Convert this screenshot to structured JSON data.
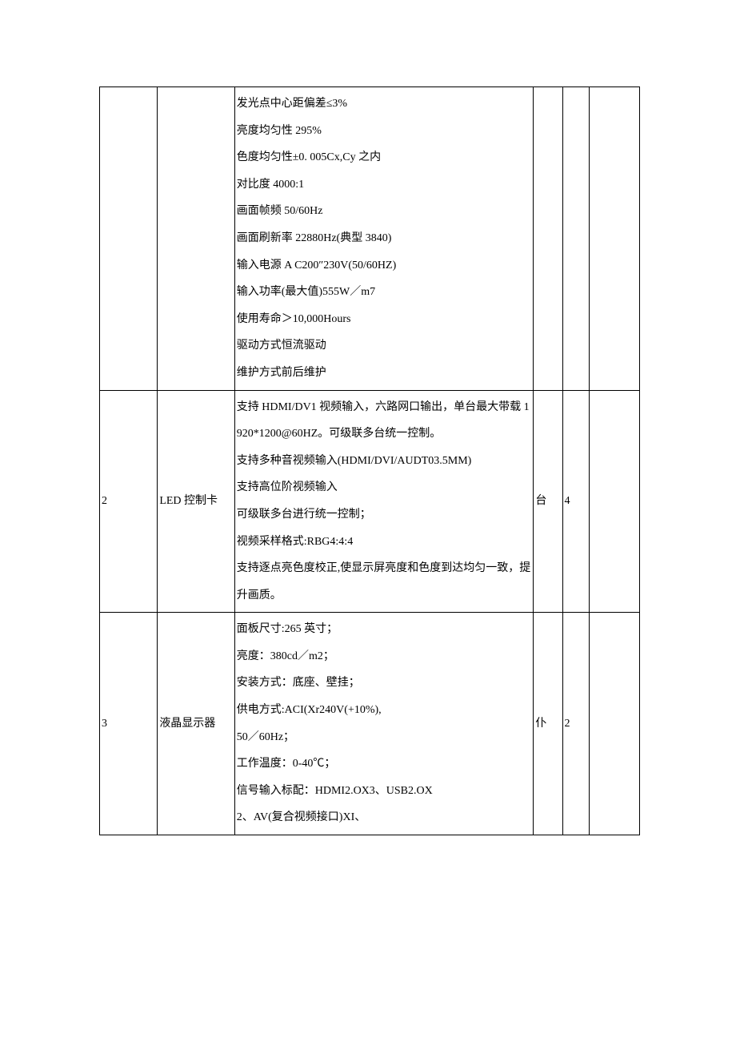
{
  "rows": [
    {
      "idx": "",
      "name": "",
      "spec": "发光点中心距偏差≤3%\n亮度均匀性 295%\n色度均匀性±0. 005Cx,Cy 之内\n对比度 4000:1\n画面帧频 50/60Hz\n画面刷新率 22880Hz(典型 3840)\n输入电源 A C200″230V(50/60HZ)\n输入功率(最大值)555W／m7\n使用寿命＞10,000Hours\n驱动方式恒流驱动\n维护方式前后维护",
      "unit": "",
      "qty": "",
      "last": ""
    },
    {
      "idx": "2",
      "name": "LED 控制卡",
      "spec": "支持 HDMI/DV1 视频输入，六路网口输出，单台最大带载 1920*1200@60HZ。可级联多台统一控制。\n支持多种音视频输入(HDMI/DVI/AUDT03.5MM)\n支持高位阶视频输入\n可级联多台进行统一控制；\n视频采样格式:RBG4:4:4\n支持逐点亮色度校正,使显示屏亮度和色度到达均匀一致，提升画质。",
      "unit": "台",
      "qty": "4",
      "last": ""
    },
    {
      "idx": "3",
      "name": "液晶显示器",
      "spec": "面板尺寸:265 英寸；\n亮度：380cd／m2；\n安装方式：底座、壁挂；\n供电方式:ACI(Xr240V(+10%),\n50／60Hz；\n工作温度：0-40℃；\n信号输入标配：HDMI2.OX3、USB2.OX\n2、AV(复合视频接口)XI、",
      "unit": "仆",
      "qty": "2",
      "last": ""
    }
  ]
}
